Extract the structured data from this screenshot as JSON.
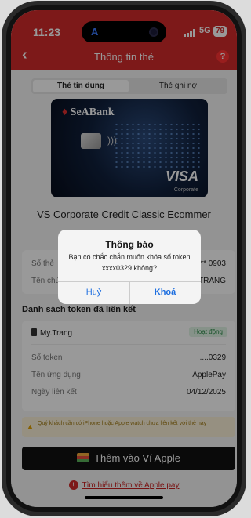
{
  "status_bar": {
    "time": "11:23",
    "network": "5G",
    "battery": "79",
    "island_label": "A"
  },
  "header": {
    "back_icon": "‹",
    "title": "Thông tin thẻ",
    "help_icon": "?"
  },
  "tabs": {
    "credit": "Thẻ tín dụng",
    "debit": "Thẻ ghi nợ"
  },
  "card": {
    "brand": "SeABank",
    "network": "VISA",
    "tier": "Corporate",
    "name": "VS Corporate Credit Classic Ecommer"
  },
  "card_info": {
    "number_label": "Số thẻ",
    "number_value": "** 0903",
    "holder_label": "Tên chủ",
    "holder_value": "TRANG"
  },
  "tokens": {
    "section_title": "Danh sách token đã liên kết",
    "device_name": "My.Trang",
    "status": "Hoạt động",
    "token_label": "Số token",
    "token_value": "....0329",
    "app_label": "Tên ứng dụng",
    "app_value": "ApplePay",
    "date_label": "Ngày liên kết",
    "date_value": "04/12/2025"
  },
  "warning": {
    "text": "Quý khách cần có iPhone hoặc Apple watch chưa liên kết với thẻ này"
  },
  "actions": {
    "apple_wallet": "Thêm vào Ví Apple",
    "learn_more": "Tìm hiểu thêm về Apple pay"
  },
  "dialog": {
    "title": "Thông báo",
    "message": "Bạn có chắc chắn muốn khóa số token xxxx0329 không?",
    "cancel": "Huỷ",
    "confirm": "Khoá"
  },
  "colors": {
    "brand_red": "#d12a2a",
    "dialog_link": "#1e6fe0"
  }
}
